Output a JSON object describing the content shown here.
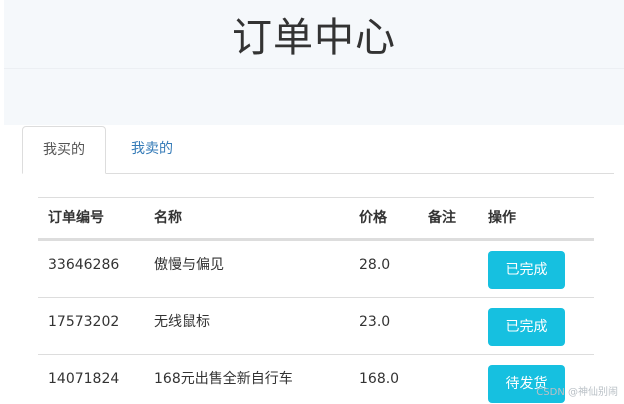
{
  "header": {
    "title": "订单中心"
  },
  "tabs": [
    {
      "label": "我买的",
      "active": true
    },
    {
      "label": "我卖的",
      "active": false
    }
  ],
  "table": {
    "columns": [
      "订单编号",
      "名称",
      "价格",
      "备注",
      "操作"
    ],
    "rows": [
      {
        "id": "33646286",
        "name": "傲慢与偏见",
        "price": "28.0",
        "note": "",
        "action": "已完成"
      },
      {
        "id": "17573202",
        "name": "无线鼠标",
        "price": "23.0",
        "note": "",
        "action": "已完成"
      },
      {
        "id": "14071824",
        "name": "168元出售全新自行车",
        "price": "168.0",
        "note": "",
        "action": "待发货"
      }
    ]
  },
  "colors": {
    "button": "#16c0e0",
    "link": "#337ab7",
    "hero_bg": "#f5f8fb"
  },
  "watermark": "CSDN @神仙别闹"
}
